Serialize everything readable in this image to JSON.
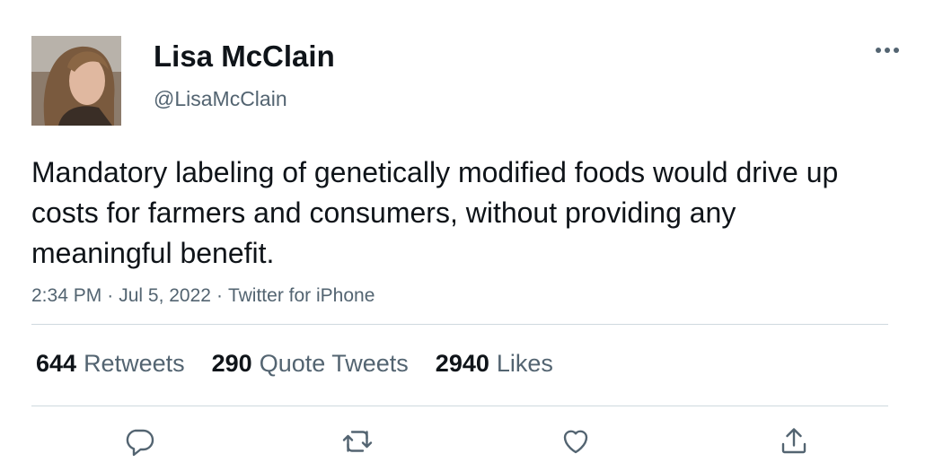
{
  "tweet": {
    "author_name": "Lisa McClain",
    "author_handle": "@LisaMcClain",
    "text": "Mandatory labeling of genetically modified foods would drive up costs for farmers and consumers, without providing any meaningful benefit.",
    "time": "2:34 PM",
    "date": "Jul 5, 2022",
    "source": "Twitter for iPhone",
    "meta_separator": "·"
  },
  "stats": {
    "retweets": {
      "count": "644",
      "label": "Retweets"
    },
    "quote_tweets": {
      "count": "290",
      "label": "Quote Tweets"
    },
    "likes": {
      "count": "2940",
      "label": "Likes"
    }
  },
  "icons": {
    "more": "more-horizontal-icon",
    "reply": "reply-icon",
    "retweet": "retweet-icon",
    "like": "heart-icon",
    "share": "share-icon"
  },
  "colors": {
    "primary_text": "#0f1419",
    "secondary_text": "#536471",
    "divider": "#cfd9de"
  }
}
